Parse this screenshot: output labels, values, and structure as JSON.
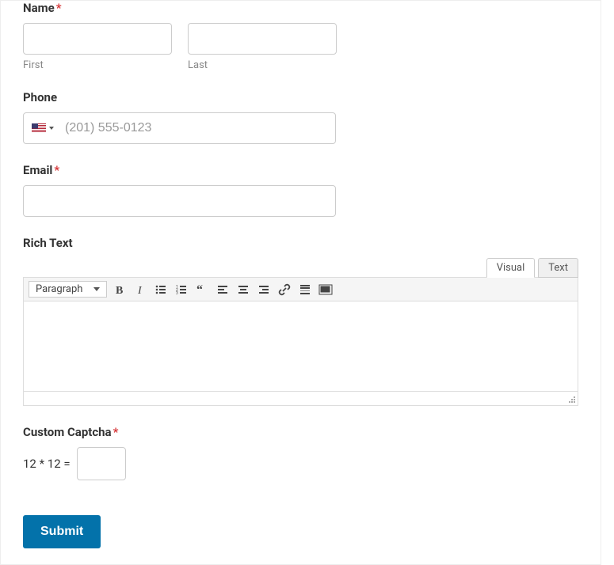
{
  "name": {
    "label": "Name",
    "required": "*",
    "first_sublabel": "First",
    "last_sublabel": "Last"
  },
  "phone": {
    "label": "Phone",
    "placeholder": "(201) 555-0123"
  },
  "email": {
    "label": "Email",
    "required": "*"
  },
  "richtext": {
    "label": "Rich Text",
    "tab_visual": "Visual",
    "tab_text": "Text",
    "format_dropdown": "Paragraph"
  },
  "captcha": {
    "label": "Custom Captcha",
    "required": "*",
    "question": "12 * 12 ="
  },
  "submit_label": "Submit"
}
